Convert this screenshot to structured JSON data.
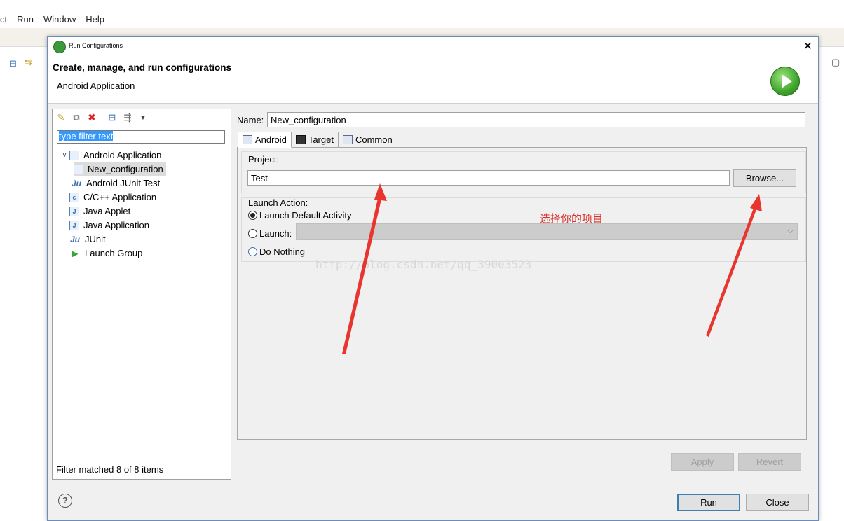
{
  "background": {
    "menu": [
      "ct",
      "Run",
      "Window",
      "Help"
    ]
  },
  "dialog": {
    "title": "Run Configurations",
    "header_title": "Create, manage, and run configurations",
    "header_subtitle": "Android Application"
  },
  "left_panel": {
    "filter_placeholder": "type filter text",
    "tree": [
      {
        "label": "Android Application",
        "icon": "android-app-icon",
        "expanded": true,
        "level": 0
      },
      {
        "label": "New_configuration",
        "icon": "config-icon",
        "level": 1,
        "selected": true
      },
      {
        "label": "Android JUnit Test",
        "icon": "junit-android-icon",
        "level": 0
      },
      {
        "label": "C/C++ Application",
        "icon": "c-app-icon",
        "level": 0
      },
      {
        "label": "Java Applet",
        "icon": "java-applet-icon",
        "level": 0
      },
      {
        "label": "Java Application",
        "icon": "java-app-icon",
        "level": 0
      },
      {
        "label": "JUnit",
        "icon": "junit-icon",
        "level": 0
      },
      {
        "label": "Launch Group",
        "icon": "launch-group-icon",
        "level": 0
      }
    ],
    "status": "Filter matched 8 of 8 items"
  },
  "right_panel": {
    "name_label": "Name:",
    "name_value": "New_configuration",
    "tabs": [
      "Android",
      "Target",
      "Common"
    ],
    "project_label": "Project:",
    "project_value": "Test",
    "browse_label": "Browse...",
    "launch_action_label": "Launch Action:",
    "radio_default": "Launch Default Activity",
    "radio_launch": "Launch:",
    "radio_nothing": "Do Nothing"
  },
  "annotation": "选择你的项目",
  "watermark": "http://blog.csdn.net/qq_39003523",
  "buttons": {
    "apply": "Apply",
    "revert": "Revert",
    "run": "Run",
    "close": "Close",
    "help": "?"
  },
  "colors": {
    "annotation_red": "#d9332b",
    "selection_blue": "#3399ff",
    "run_green": "#3ea52b"
  }
}
